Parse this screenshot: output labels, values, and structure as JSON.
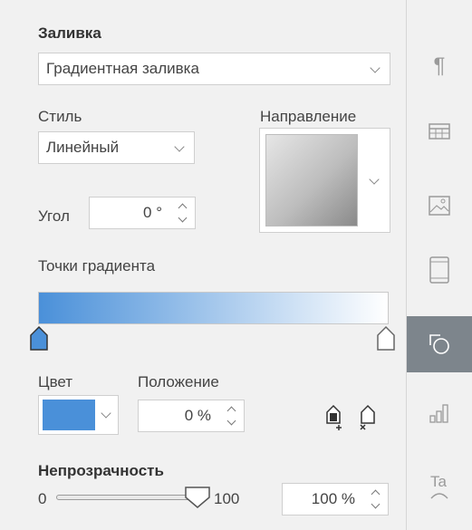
{
  "fill": {
    "heading": "Заливка",
    "type_value": "Градиентная заливка"
  },
  "style": {
    "label": "Стиль",
    "value": "Линейный"
  },
  "direction": {
    "label": "Направление"
  },
  "angle": {
    "label": "Угол",
    "value": "0 °"
  },
  "gradient": {
    "label": "Точки градиента",
    "start_color": "#4a90d9",
    "end_color": "#ffffff"
  },
  "color": {
    "label": "Цвет",
    "swatch": "#4a90d9"
  },
  "position": {
    "label": "Положение",
    "value": "0 %"
  },
  "opacity": {
    "heading": "Непрозрачность",
    "min_label": "0",
    "max_label": "100",
    "value": "100 %",
    "level_percent": 100
  },
  "sidebar": {
    "items": [
      {
        "icon": "paragraph-icon",
        "active": false
      },
      {
        "icon": "table-icon",
        "active": false
      },
      {
        "icon": "image-icon",
        "active": false
      },
      {
        "icon": "slide-icon",
        "active": false
      },
      {
        "icon": "shape-icon",
        "active": true
      },
      {
        "icon": "chart-icon",
        "active": false
      },
      {
        "icon": "textart-icon",
        "active": false
      }
    ]
  }
}
